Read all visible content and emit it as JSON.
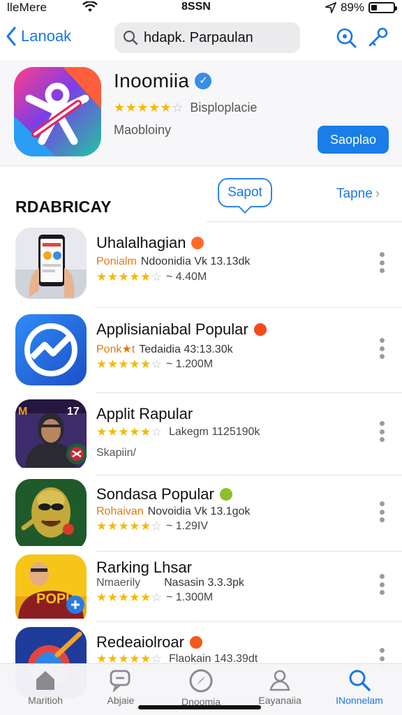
{
  "status_bar": {
    "carrier": "lleMere",
    "time": "8SSN",
    "battery": "89%",
    "battery_level": 0.25
  },
  "nav": {
    "back_label": "Lanoak",
    "search_value": "hdapk. Parpaulan",
    "icons": [
      "search-icon",
      "key-icon"
    ]
  },
  "hero": {
    "title": "Inoomiia",
    "rating_text": "Bisploplacie",
    "rating": 4.5,
    "developer": "Maobloiny",
    "button": "Saoplao",
    "accent": "#1a7de8"
  },
  "section": {
    "title": "RDABRICAY",
    "bubble": "Sapot",
    "see_all": "Tapne"
  },
  "apps": [
    {
      "title": "Uhalalhagian",
      "category": "Ponialm",
      "meta": "Ndoonidia  Vk 13.13dk",
      "count": "4.40M",
      "rating": 4.5
    },
    {
      "title": "Applisianiabal Popular",
      "category": "Ponk★t",
      "meta": "Tedaidia  43:13.30k",
      "count": "1.200M",
      "rating": 4.5
    },
    {
      "title": "Applit Rapular",
      "category": "",
      "meta": "Lakegm 1125190k",
      "count": "",
      "sub": "Skapiin/",
      "rating": 4.5
    },
    {
      "title": "Sondasa Popular",
      "category": "Rohaivan",
      "meta": "Novoidia  Vk 13.1gok",
      "count": "1.29IV",
      "rating": 4.5
    },
    {
      "title": "Rarking Lhsar",
      "category": "Nmaerily",
      "meta": "Nasasin 3.3.3pk",
      "count": "1.300M",
      "rating": 4.5
    },
    {
      "title": "Redeaiolroar",
      "category": "",
      "meta": "Flaokain 143.39dt",
      "count": "",
      "rating": 4.5
    }
  ],
  "tabs": [
    {
      "label": "Maritioh",
      "icon": "home-icon",
      "active": false
    },
    {
      "label": "Abjaie",
      "icon": "chat-icon",
      "active": false
    },
    {
      "label": "Dnoomia",
      "icon": "compass-icon",
      "active": false
    },
    {
      "label": "Eayanaiia",
      "icon": "person-icon",
      "active": false
    },
    {
      "label": "INonnelam",
      "icon": "search-icon",
      "active": true
    }
  ]
}
